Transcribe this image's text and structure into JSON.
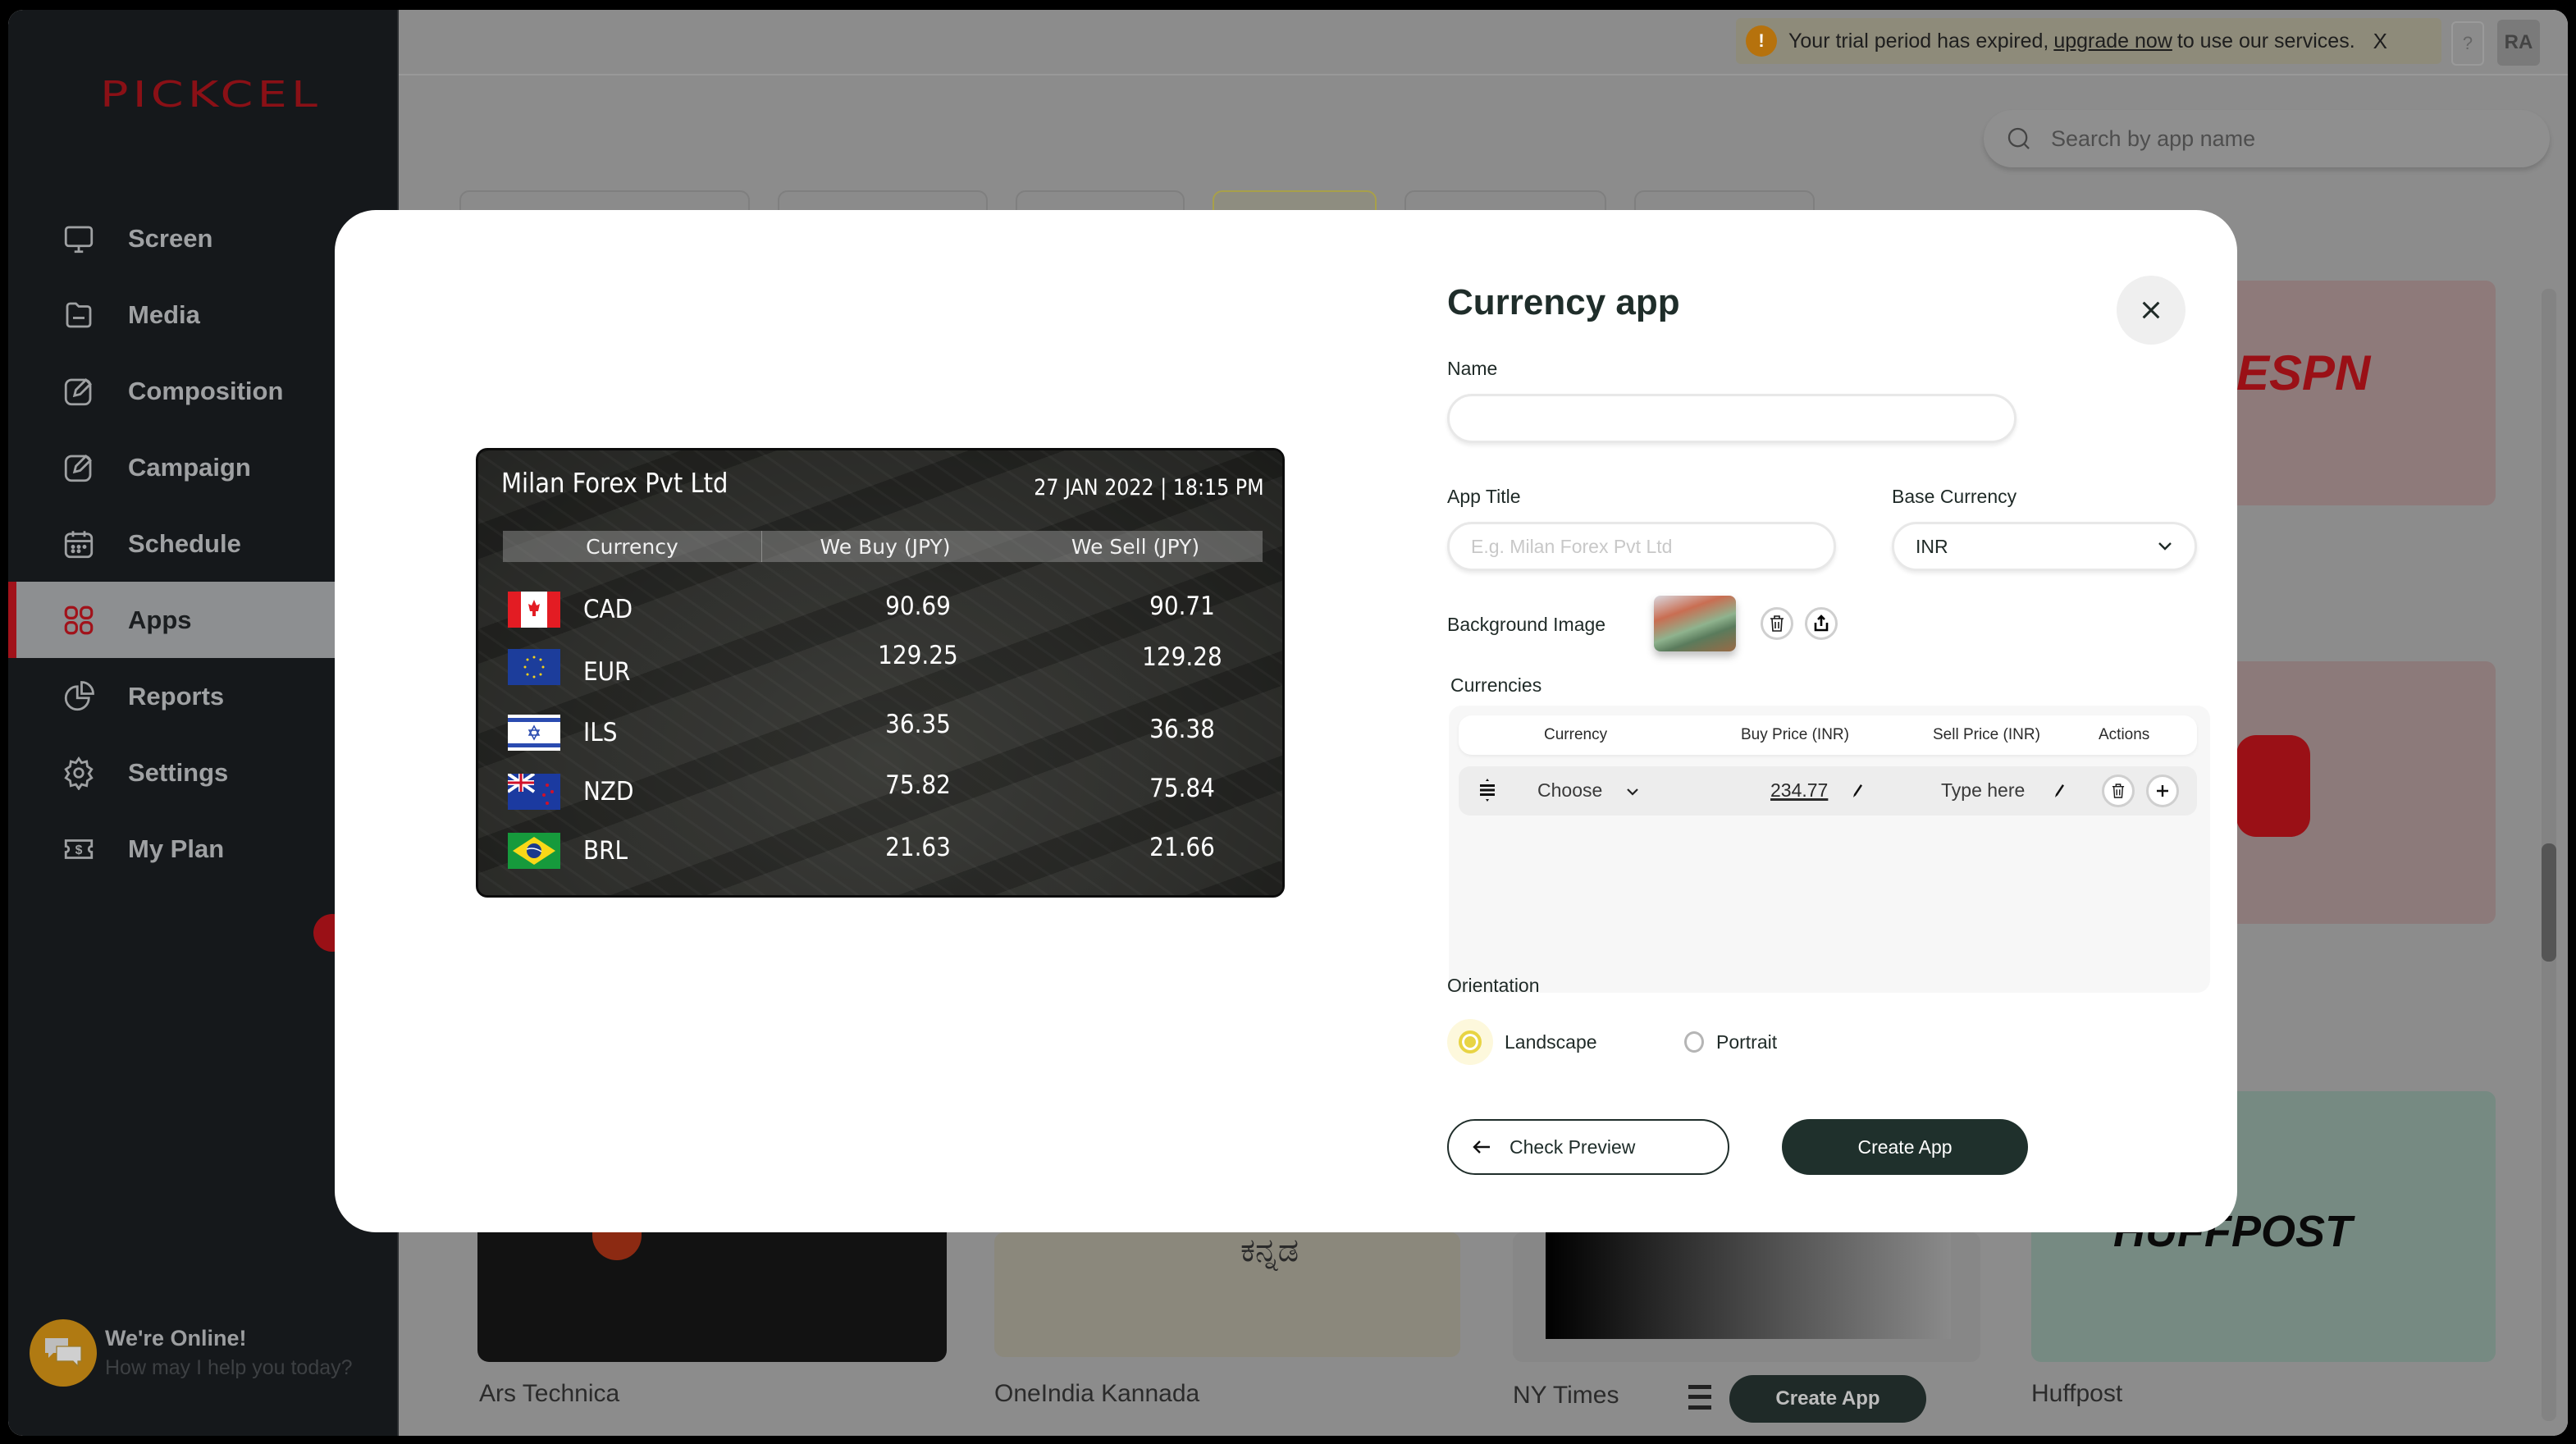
{
  "brand": {
    "logo": "PICKCEL",
    "accent": "#a1121a"
  },
  "sidebar": {
    "items": [
      {
        "label": "Screen",
        "icon": "monitor-icon",
        "active": false
      },
      {
        "label": "Media",
        "icon": "folder-icon",
        "active": false
      },
      {
        "label": "Composition",
        "icon": "edit-icon",
        "active": false
      },
      {
        "label": "Campaign",
        "icon": "edit-icon",
        "active": false
      },
      {
        "label": "Schedule",
        "icon": "calendar-icon",
        "active": false
      },
      {
        "label": "Apps",
        "icon": "grid-icon",
        "active": true
      },
      {
        "label": "Reports",
        "icon": "pie-chart-icon",
        "active": false
      },
      {
        "label": "Settings",
        "icon": "gear-icon",
        "active": false
      },
      {
        "label": "My Plan",
        "icon": "dollar-ticket-icon",
        "active": false
      }
    ],
    "chat": {
      "title": "We're Online!",
      "subtitle": "How may I help you today?"
    }
  },
  "topbar": {
    "trial_prefix": "Your trial period has expired,",
    "trial_link": "upgrade now",
    "trial_suffix": "to use our services.",
    "trial_close": "X",
    "help": "?",
    "avatar": "RA"
  },
  "search": {
    "placeholder": "Search by app name"
  },
  "background_apps": [
    {
      "name": "ESPN"
    },
    {
      "name": "Ars Technica"
    },
    {
      "name": "OneIndia Kannada",
      "logo_text": "ಕನ್ನಡ"
    },
    {
      "name": "NY Times"
    },
    {
      "name": "Huffpost",
      "logo_text": "HUFFPOST"
    }
  ],
  "background_create_label": "Create App",
  "modal": {
    "title": "Currency app",
    "preview": {
      "title": "Milan Forex Pvt Ltd",
      "datetime": "27 JAN 2022 | 18:15 PM",
      "headers": [
        "Currency",
        "We Buy (JPY)",
        "We Sell (JPY)"
      ],
      "rows": [
        {
          "code": "CAD",
          "flag": "canada-flag",
          "buy": "90.69",
          "sell": "90.71"
        },
        {
          "code": "EUR",
          "flag": "eu-flag",
          "buy": "129.25",
          "sell": "129.28"
        },
        {
          "code": "ILS",
          "flag": "israel-flag",
          "buy": "36.35",
          "sell": "36.38"
        },
        {
          "code": "NZD",
          "flag": "new-zealand-flag",
          "buy": "75.82",
          "sell": "75.84"
        },
        {
          "code": "BRL",
          "flag": "brazil-flag",
          "buy": "21.63",
          "sell": "21.66"
        }
      ]
    },
    "form": {
      "name_label": "Name",
      "name_value": "",
      "app_title_label": "App Title",
      "app_title_placeholder": "E.g. Milan Forex Pvt Ltd",
      "base_currency_label": "Base Currency",
      "base_currency_value": "INR",
      "background_image_label": "Background Image",
      "currencies_label": "Currencies",
      "table_headers": [
        "Currency",
        "Buy Price (INR)",
        "Sell Price (INR)",
        "Actions"
      ],
      "table_rows": [
        {
          "currency": "Choose",
          "buy": "234.77",
          "sell_placeholder": "Type here"
        }
      ],
      "orientation_label": "Orientation",
      "orientation_options": [
        "Landscape",
        "Portrait"
      ],
      "orientation_selected": "Landscape",
      "check_preview_label": "Check Preview",
      "create_app_label": "Create App"
    }
  }
}
